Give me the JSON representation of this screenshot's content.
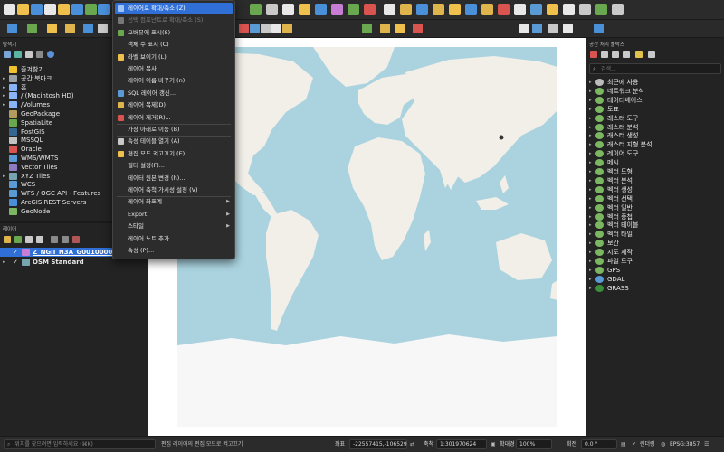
{
  "left_panel": {
    "browser_title": "탐색기",
    "browser_items": [
      {
        "label": "즐겨찾기",
        "icon": "star-icon",
        "color": "#f2c12e",
        "caret": ""
      },
      {
        "label": "공간 북마크",
        "icon": "bookmark-icon",
        "color": "#9aa0a6",
        "caret": "▸"
      },
      {
        "label": "홈",
        "icon": "folder-icon",
        "color": "#8ab4f8",
        "caret": "▸"
      },
      {
        "label": "/ (Macintosh HD)",
        "icon": "folder-icon",
        "color": "#8ab4f8",
        "caret": "▸"
      },
      {
        "label": "/Volumes",
        "icon": "folder-icon",
        "color": "#8ab4f8",
        "caret": "▸"
      },
      {
        "label": "GeoPackage",
        "icon": "geopackage-icon",
        "color": "#b39b5f",
        "caret": ""
      },
      {
        "label": "SpatiaLite",
        "icon": "spatialite-icon",
        "color": "#6aa84f",
        "caret": ""
      },
      {
        "label": "PostGIS",
        "icon": "postgis-icon",
        "color": "#336791",
        "caret": ""
      },
      {
        "label": "MSSQL",
        "icon": "mssql-icon",
        "color": "#c2c2c2",
        "caret": ""
      },
      {
        "label": "Oracle",
        "icon": "oracle-icon",
        "color": "#d9534f",
        "caret": ""
      },
      {
        "label": "WMS/WMTS",
        "icon": "globe-icon",
        "color": "#5b9bd5",
        "caret": ""
      },
      {
        "label": "Vector Tiles",
        "icon": "vector-tiles-icon",
        "color": "#8e7cc3",
        "caret": ""
      },
      {
        "label": "XYZ Tiles",
        "icon": "xyz-tiles-icon",
        "color": "#76a5af",
        "caret": "▸"
      },
      {
        "label": "WCS",
        "icon": "globe-icon",
        "color": "#5b9bd5",
        "caret": ""
      },
      {
        "label": "WFS / OGC API - Features",
        "icon": "globe-icon",
        "color": "#5b9bd5",
        "caret": ""
      },
      {
        "label": "ArcGIS REST Servers",
        "icon": "arcgis-icon",
        "color": "#4a90d9",
        "caret": ""
      },
      {
        "label": "GeoNode",
        "icon": "geonode-icon",
        "color": "#7bb661",
        "caret": ""
      }
    ],
    "layers_title": "레이어",
    "layers": [
      {
        "label": "Z_NGII_N3A_G0010000",
        "checked": "✓"
      },
      {
        "label": "OSM Standard",
        "checked": "✓"
      }
    ]
  },
  "context_menu": {
    "items": [
      {
        "label": "레이어로 확대/축소 (Z)",
        "state": "active",
        "icon": "zoom-layer-icon",
        "has_sub": false
      },
      {
        "label": "선택 컴포넌트로 확대/축소 (S)",
        "state": "disabled",
        "icon": "zoom-selection-icon",
        "has_sub": false
      },
      {
        "label": "오버뷰에 표시(S)",
        "state": "",
        "icon": "overview-icon",
        "has_sub": false
      },
      {
        "label": "객체 수 표시 (C)",
        "state": "",
        "icon": "",
        "has_sub": false
      },
      {
        "label": "라벨 보이기 (L)",
        "state": "",
        "icon": "label-icon",
        "has_sub": false
      },
      {
        "label": "레이어 복사",
        "state": "",
        "icon": "",
        "has_sub": false
      },
      {
        "label": "레이어 이름 바꾸기 (n)",
        "state": "",
        "icon": "",
        "has_sub": false
      },
      {
        "label": "SQL 레이어 갱신...",
        "state": "",
        "icon": "sql-icon",
        "has_sub": false
      },
      {
        "label": "레이어 복제(D)",
        "state": "",
        "icon": "duplicate-icon",
        "has_sub": false
      },
      {
        "label": "레이어 제거(R)...",
        "state": "",
        "icon": "remove-layer-icon",
        "has_sub": false
      },
      {
        "label": "가장 아래로 이동 (B)",
        "state": "",
        "icon": "",
        "has_sub": false
      },
      {
        "label": "속성 테이블 열기 (A)",
        "state": "",
        "icon": "attribute-table-icon",
        "has_sub": false
      },
      {
        "label": "편집 모드 켜고끄기 (E)",
        "state": "",
        "icon": "pencil-icon",
        "has_sub": false
      },
      {
        "label": "필터 설정(F)...",
        "state": "",
        "icon": "",
        "has_sub": false
      },
      {
        "label": "데이터 원본 변경 (h)...",
        "state": "",
        "icon": "",
        "has_sub": false
      },
      {
        "label": "레이어 축척 가시성 설정 (V)",
        "state": "",
        "icon": "",
        "has_sub": false
      },
      {
        "label": "레이어 좌표계",
        "state": "",
        "icon": "",
        "has_sub": true
      },
      {
        "label": "Export",
        "state": "",
        "icon": "",
        "has_sub": true
      },
      {
        "label": "스타일",
        "state": "",
        "icon": "",
        "has_sub": true
      },
      {
        "label": "레이어 노트 추가...",
        "state": "",
        "icon": "",
        "has_sub": false
      },
      {
        "label": "속성 (P)...",
        "state": "",
        "icon": "",
        "has_sub": false
      }
    ]
  },
  "right_panel": {
    "title": "공간 처리 툴박스",
    "search_placeholder": "검색...",
    "items": [
      {
        "label": "최근에 사용",
        "icon": "clock-icon",
        "color": "#bbbbbb"
      },
      {
        "label": "네트워크 분석",
        "icon": "qgis-icon",
        "color": "#7bb661"
      },
      {
        "label": "데이터베이스",
        "icon": "qgis-icon",
        "color": "#7bb661"
      },
      {
        "label": "도표",
        "icon": "qgis-icon",
        "color": "#7bb661"
      },
      {
        "label": "래스터 도구",
        "icon": "qgis-icon",
        "color": "#7bb661"
      },
      {
        "label": "래스터 분석",
        "icon": "qgis-icon",
        "color": "#7bb661"
      },
      {
        "label": "래스터 생성",
        "icon": "qgis-icon",
        "color": "#7bb661"
      },
      {
        "label": "래스터 지형 분석",
        "icon": "qgis-icon",
        "color": "#7bb661"
      },
      {
        "label": "레이어 도구",
        "icon": "qgis-icon",
        "color": "#7bb661"
      },
      {
        "label": "메시",
        "icon": "qgis-icon",
        "color": "#7bb661"
      },
      {
        "label": "벡터 도형",
        "icon": "qgis-icon",
        "color": "#7bb661"
      },
      {
        "label": "벡터 분석",
        "icon": "qgis-icon",
        "color": "#7bb661"
      },
      {
        "label": "벡터 생성",
        "icon": "qgis-icon",
        "color": "#7bb661"
      },
      {
        "label": "벡터 선택",
        "icon": "qgis-icon",
        "color": "#7bb661"
      },
      {
        "label": "벡터 일반",
        "icon": "qgis-icon",
        "color": "#7bb661"
      },
      {
        "label": "벡터 중첩",
        "icon": "qgis-icon",
        "color": "#7bb661"
      },
      {
        "label": "벡터 테이블",
        "icon": "qgis-icon",
        "color": "#7bb661"
      },
      {
        "label": "벡터 타일",
        "icon": "qgis-icon",
        "color": "#7bb661"
      },
      {
        "label": "보간",
        "icon": "qgis-icon",
        "color": "#7bb661"
      },
      {
        "label": "지도 제작",
        "icon": "qgis-icon",
        "color": "#7bb661"
      },
      {
        "label": "파일 도구",
        "icon": "qgis-icon",
        "color": "#7bb661"
      },
      {
        "label": "GPS",
        "icon": "qgis-icon",
        "color": "#7bb661"
      },
      {
        "label": "GDAL",
        "icon": "gdal-icon",
        "color": "#5b9bd5"
      },
      {
        "label": "GRASS",
        "icon": "grass-icon",
        "color": "#3c8d3c"
      }
    ]
  },
  "status_bar": {
    "locator_placeholder": "위치를 찾으려면 입력하세요 (⌘K)",
    "message": "편집 레이어의 편집 모드로 켜고끄기",
    "coord_label": "좌표",
    "coord_value": "-22557415,-106529",
    "scale_label": "축척",
    "scale_value": "1:301970624",
    "magnifier_label": "확대경",
    "magnifier_value": "100%",
    "rotation_label": "회전",
    "rotation_value": "0.0 °",
    "render_label": "렌더링",
    "crs_label": "EPSG:3857"
  },
  "colors": {
    "accent": "#2f6fd6",
    "land": "#f2efe9",
    "sea": "#aad3df",
    "ice": "#f7f7f7"
  }
}
